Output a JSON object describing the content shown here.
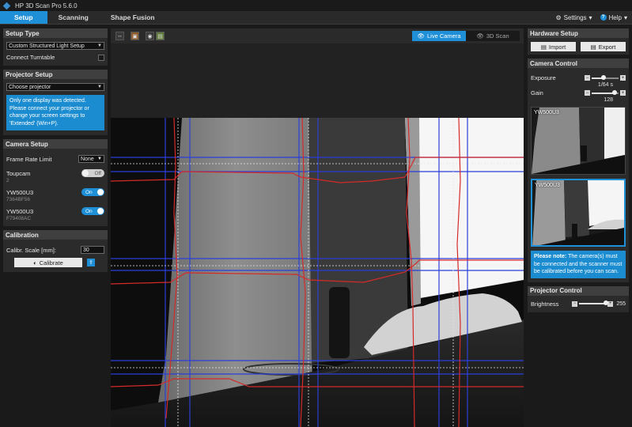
{
  "window": {
    "title": "HP 3D Scan Pro 5.6.0"
  },
  "menu": {
    "tabs": [
      "Setup",
      "Scanning",
      "Shape Fusion"
    ],
    "settings_label": "Settings",
    "help_label": "Help"
  },
  "setup_type": {
    "header": "Setup Type",
    "selected": "Custom Structured Light Setup",
    "turntable_label": "Connect Turntable"
  },
  "projector_setup": {
    "header": "Projector Setup",
    "selected": "Choose projector",
    "info": "Only one display was detected. Please connect your projector or change your screen settings to 'Extended' (Win+P)."
  },
  "camera_setup": {
    "header": "Camera Setup",
    "frame_rate_label": "Frame Rate Limit",
    "frame_rate_value": "None",
    "cameras": [
      {
        "name": "Toupcam",
        "sub": "2",
        "state": "Off"
      },
      {
        "name": "YW500U3",
        "sub": "7364BF56",
        "state": "On"
      },
      {
        "name": "YW500U3",
        "sub": "F79408AC",
        "state": "On"
      }
    ]
  },
  "calibration": {
    "header": "Calibration",
    "scale_label": "Calibr. Scale [mm]:",
    "scale_value": "30",
    "button_label": "Calibrate"
  },
  "viewer": {
    "live_camera_label": "Live Camera",
    "scan_3d_label": "3D Scan"
  },
  "hardware_setup": {
    "header": "Hardware Setup",
    "import_label": "Import",
    "export_label": "Export"
  },
  "camera_control": {
    "header": "Camera Control",
    "exposure_label": "Exposure",
    "exposure_value": "1/64 s",
    "exposure_level": 0.45,
    "gain_label": "Gain",
    "gain_value": "128",
    "gain_level": 0.85,
    "thumbnails": [
      "YW500U3",
      "YW500U3"
    ],
    "note_bold": "Please note:",
    "note_text": "The camera(s) must be connected and the scanner must be calibrated before you can scan."
  },
  "projector_control": {
    "header": "Projector Control",
    "brightness_label": "Brightness",
    "brightness_value": "255",
    "brightness_level": 1.0
  },
  "colors": {
    "accent": "#1f8fd8",
    "overlay_red": "#d42a2a",
    "overlay_blue": "#2b3fd8"
  }
}
